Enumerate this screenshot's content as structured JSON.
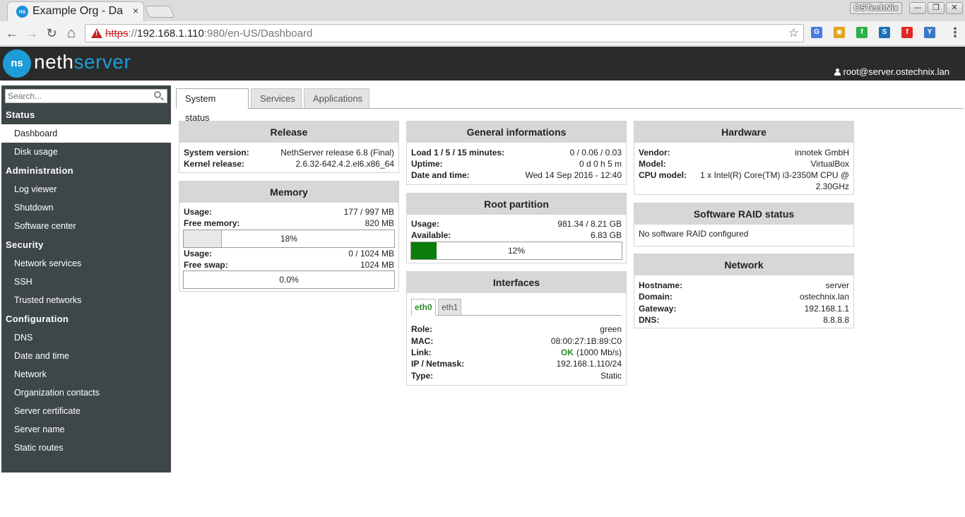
{
  "browser": {
    "tab_title": "Example Org - Da",
    "tab_close": "×",
    "profile_name": "OSTechNix",
    "window_minimize": "—",
    "window_restore": "❐",
    "window_close": "✕",
    "back": "←",
    "forward": "→",
    "reload": "↻",
    "home": "⌂",
    "url_scheme": "https",
    "url_sep": "://",
    "url_host": "192.168.1.110",
    "url_rest": ":980/en-US/Dashboard",
    "bookmark_star": "☆",
    "menu": "⋮",
    "extensions": [
      {
        "name": "google-translate-icon",
        "glyph": "G",
        "color": "#4a7be4"
      },
      {
        "name": "chrome-remote-icon",
        "glyph": "◉",
        "color": "#e0a51e"
      },
      {
        "name": "feedly-icon",
        "glyph": "f",
        "color": "#2bb24c"
      },
      {
        "name": "s-ext-icon",
        "glyph": "S",
        "color": "#1d6fb8"
      },
      {
        "name": "flipboard-icon",
        "glyph": "f",
        "color": "#e12828"
      },
      {
        "name": "y-ext-icon",
        "glyph": "Y",
        "color": "#3a78c8"
      }
    ]
  },
  "header": {
    "logo_mark": "ns",
    "logo_neth": "neth",
    "logo_server": "server",
    "user": "root@server.ostechnix.lan"
  },
  "sidebar": {
    "search_placeholder": "Search...",
    "sections": [
      {
        "title": "Status",
        "items": [
          "Dashboard",
          "Disk usage"
        ]
      },
      {
        "title": "Administration",
        "items": [
          "Log viewer",
          "Shutdown",
          "Software center"
        ]
      },
      {
        "title": "Security",
        "items": [
          "Network services",
          "SSH",
          "Trusted networks"
        ]
      },
      {
        "title": "Configuration",
        "items": [
          "DNS",
          "Date and time",
          "Network",
          "Organization contacts",
          "Server certificate",
          "Server name",
          "Static routes"
        ]
      }
    ]
  },
  "tabs": [
    "System status",
    "Services",
    "Applications"
  ],
  "release": {
    "title": "Release",
    "system_version_label": "System version:",
    "system_version": "NethServer release 6.8 (Final)",
    "kernel_label": "Kernel release:",
    "kernel": "2.6.32-642.4.2.el6.x86_64"
  },
  "memory": {
    "title": "Memory",
    "usage_label": "Usage:",
    "usage": "177 / 997 MB",
    "free_label": "Free memory:",
    "free": "820 MB",
    "mem_percent": 18,
    "mem_percent_label": "18%",
    "mem_bar_color": "#e8e8e8",
    "swap_usage_label": "Usage:",
    "swap_usage": "0 / 1024 MB",
    "swap_free_label": "Free swap:",
    "swap_free": "1024 MB",
    "swap_percent": 0,
    "swap_percent_label": "0.0%"
  },
  "general": {
    "title": "General informations",
    "load_label": "Load 1 / 5 / 15 minutes:",
    "load": "0 / 0.06 / 0.03",
    "uptime_label": "Uptime:",
    "uptime": "0 d 0 h 5 m",
    "date_label": "Date and time:",
    "date": "Wed 14 Sep 2016 - 12:40"
  },
  "root_partition": {
    "title": "Root partition",
    "usage_label": "Usage:",
    "usage": "981.34 / 8.21 GB",
    "available_label": "Available:",
    "available": "6.83 GB",
    "percent": 12,
    "percent_label": "12%",
    "bar_color": "#0b7d0b"
  },
  "interfaces": {
    "title": "Interfaces",
    "tabs": [
      "eth0",
      "eth1"
    ],
    "role_label": "Role:",
    "role": "green",
    "mac_label": "MAC:",
    "mac": "08:00:27:1B:89:C0",
    "link_label": "Link:",
    "link_status": "OK",
    "link_speed": "(1000 Mb/s)",
    "ip_label": "IP / Netmask:",
    "ip": "192.168.1.110/24",
    "type_label": "Type:",
    "type": "Static"
  },
  "hardware": {
    "title": "Hardware",
    "vendor_label": "Vendor:",
    "vendor": "innotek GmbH",
    "model_label": "Model:",
    "model": "VirtualBox",
    "cpu_label": "CPU model:",
    "cpu_line1": "1 x Intel(R) Core(TM) i3-2350M CPU @",
    "cpu_line2": "2.30GHz"
  },
  "raid": {
    "title": "Software RAID status",
    "message": "No software RAID configured"
  },
  "network": {
    "title": "Network",
    "hostname_label": "Hostname:",
    "hostname": "server",
    "domain_label": "Domain:",
    "domain": "ostechnix.lan",
    "gateway_label": "Gateway:",
    "gateway": "192.168.1.1",
    "dns_label": "DNS:",
    "dns": "8.8.8.8"
  }
}
